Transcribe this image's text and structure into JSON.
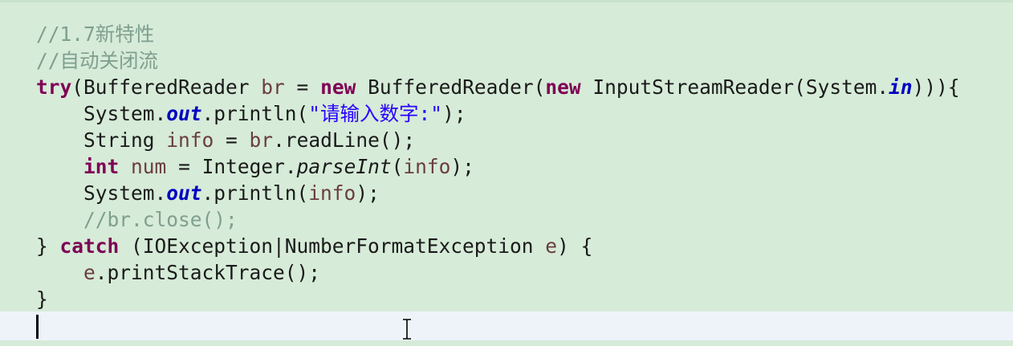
{
  "editor": {
    "background": "#d6ebd8",
    "current_line_background": "#eef3f9",
    "colors": {
      "comment": "#7f9f8f",
      "keyword": "#7f0055",
      "local_variable": "#6a3e3e",
      "static_field": "#0000c0",
      "string": "#2a00ff",
      "default": "#1a1a1a"
    },
    "lines": [
      {
        "tokens": [
          {
            "text": "//1.7新特性",
            "kind": "comment"
          }
        ]
      },
      {
        "tokens": [
          {
            "text": "//自动关闭流",
            "kind": "comment"
          }
        ]
      },
      {
        "tokens": [
          {
            "text": "try",
            "kind": "keyword"
          },
          {
            "text": "(BufferedReader ",
            "kind": "plain"
          },
          {
            "text": "br",
            "kind": "local_variable"
          },
          {
            "text": " = ",
            "kind": "plain"
          },
          {
            "text": "new",
            "kind": "keyword"
          },
          {
            "text": " BufferedReader(",
            "kind": "plain"
          },
          {
            "text": "new",
            "kind": "keyword"
          },
          {
            "text": " InputStreamReader(System.",
            "kind": "plain"
          },
          {
            "text": "in",
            "kind": "static_field"
          },
          {
            "text": "))){",
            "kind": "plain"
          }
        ]
      },
      {
        "tokens": [
          {
            "text": "    System.",
            "kind": "plain"
          },
          {
            "text": "out",
            "kind": "static_field"
          },
          {
            "text": ".println(",
            "kind": "plain"
          },
          {
            "text": "\"请输入数字:\"",
            "kind": "string"
          },
          {
            "text": ");",
            "kind": "plain"
          }
        ]
      },
      {
        "tokens": [
          {
            "text": "    String ",
            "kind": "plain"
          },
          {
            "text": "info",
            "kind": "local_variable"
          },
          {
            "text": " = ",
            "kind": "plain"
          },
          {
            "text": "br",
            "kind": "local_variable"
          },
          {
            "text": ".readLine();",
            "kind": "plain"
          }
        ]
      },
      {
        "tokens": [
          {
            "text": "    ",
            "kind": "plain"
          },
          {
            "text": "int",
            "kind": "keyword"
          },
          {
            "text": " ",
            "kind": "plain"
          },
          {
            "text": "num",
            "kind": "local_variable"
          },
          {
            "text": " = Integer.",
            "kind": "plain"
          },
          {
            "text": "parseInt",
            "kind": "static_method"
          },
          {
            "text": "(",
            "kind": "plain"
          },
          {
            "text": "info",
            "kind": "local_variable"
          },
          {
            "text": ");",
            "kind": "plain"
          }
        ]
      },
      {
        "tokens": [
          {
            "text": "    System.",
            "kind": "plain"
          },
          {
            "text": "out",
            "kind": "static_field"
          },
          {
            "text": ".println(",
            "kind": "plain"
          },
          {
            "text": "info",
            "kind": "local_variable"
          },
          {
            "text": ");",
            "kind": "plain"
          }
        ]
      },
      {
        "tokens": [
          {
            "text": "    ",
            "kind": "plain"
          },
          {
            "text": "//br.close();",
            "kind": "comment"
          }
        ]
      },
      {
        "tokens": [
          {
            "text": "} ",
            "kind": "plain"
          },
          {
            "text": "catch",
            "kind": "keyword"
          },
          {
            "text": " (IOException|NumberFormatException ",
            "kind": "plain"
          },
          {
            "text": "e",
            "kind": "local_variable"
          },
          {
            "text": ") {",
            "kind": "plain"
          }
        ]
      },
      {
        "tokens": [
          {
            "text": "    ",
            "kind": "plain"
          },
          {
            "text": "e",
            "kind": "local_variable"
          },
          {
            "text": ".printStackTrace();",
            "kind": "plain"
          }
        ]
      },
      {
        "tokens": [
          {
            "text": "}",
            "kind": "plain"
          }
        ]
      },
      {
        "tokens": [
          {
            "text": "",
            "kind": "plain"
          }
        ]
      }
    ],
    "cursor_line": 12,
    "mouse_pointer": "i-beam-cursor-icon"
  }
}
